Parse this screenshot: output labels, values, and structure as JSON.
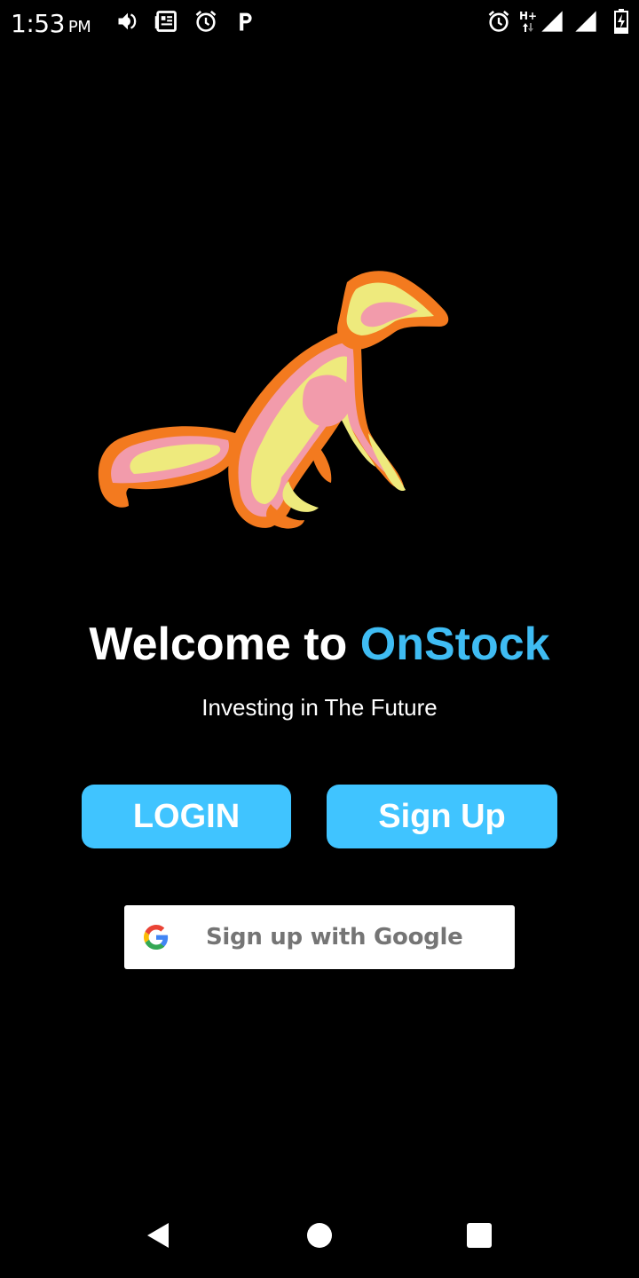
{
  "status_bar": {
    "time": "1:53",
    "ampm": "PM",
    "icons": [
      "volume-icon",
      "news-icon",
      "alarm-icon",
      "parking-icon",
      "alarm-icon",
      "hplus-network-icon",
      "signal-icon",
      "signal-icon",
      "battery-charging-icon"
    ]
  },
  "logo": {
    "icon": "fox-logo",
    "colors": {
      "orange": "#f37a1f",
      "pink": "#f29bab",
      "yellow": "#eeea7d"
    }
  },
  "welcome": {
    "prefix": "Welcome to ",
    "brand": "OnStock",
    "brand_color": "#3fbcf3"
  },
  "tagline": "Investing in The Future",
  "buttons": {
    "login_label": "LOGIN",
    "signup_label": "Sign Up",
    "color": "#40c4ff"
  },
  "google_button": {
    "label": "Sign up with Google",
    "icon": "google-g-icon"
  },
  "nav_bar": {
    "icons": [
      "back-icon",
      "home-icon",
      "recents-icon"
    ]
  }
}
